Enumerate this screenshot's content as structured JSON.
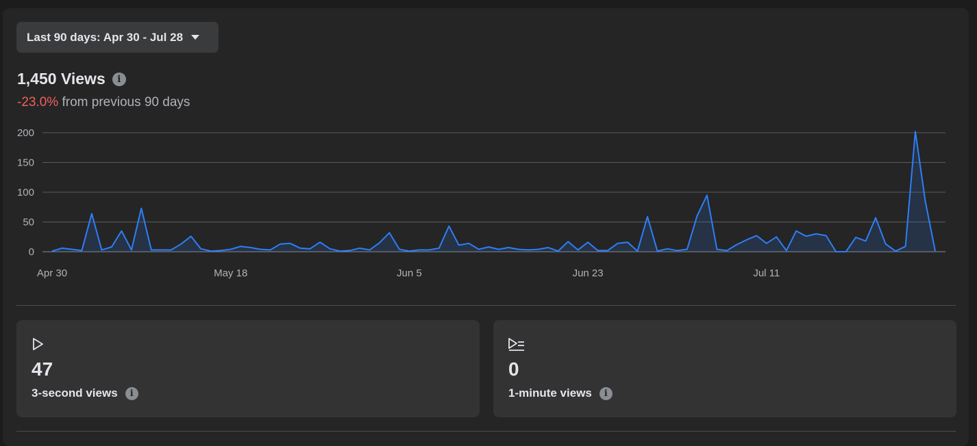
{
  "date_range": {
    "label": "Last 90 days: Apr 30 - Jul 28",
    "icon": "caret-down-icon"
  },
  "views": {
    "title": "1,450 Views",
    "info_icon": "info-icon",
    "change": "-23.0%",
    "change_suffix": " from previous 90 days",
    "change_color": "#f3615c"
  },
  "chart_data": {
    "type": "area",
    "title": "",
    "xlabel": "",
    "ylabel": "",
    "ylim": [
      0,
      200
    ],
    "yticks": [
      0,
      50,
      100,
      150,
      200
    ],
    "x_tick_labels": [
      "Apr 30",
      "May 18",
      "Jun 5",
      "Jun 23",
      "Jul 11"
    ],
    "x_tick_index": [
      0,
      18,
      36,
      54,
      72
    ],
    "series": [
      {
        "color": "#2d7ff9",
        "values": [
          1,
          6,
          4,
          2,
          64,
          3,
          8,
          35,
          3,
          73,
          3,
          3,
          3,
          13,
          26,
          5,
          1,
          2,
          4,
          9,
          7,
          4,
          3,
          13,
          14,
          6,
          5,
          16,
          5,
          1,
          2,
          6,
          3,
          15,
          32,
          4,
          1,
          3,
          3,
          6,
          43,
          11,
          14,
          4,
          8,
          4,
          7,
          4,
          3,
          4,
          7,
          1,
          17,
          3,
          16,
          2,
          2,
          14,
          16,
          1,
          59,
          1,
          5,
          2,
          4,
          60,
          95,
          4,
          2,
          12,
          20,
          27,
          14,
          25,
          2,
          35,
          26,
          30,
          27,
          0,
          0,
          24,
          18,
          57,
          13,
          1,
          9,
          202,
          85,
          1
        ]
      }
    ],
    "grid": true
  },
  "cards": [
    {
      "icon": "play-icon",
      "value": "47",
      "label": "3-second views",
      "info_icon": "info-icon"
    },
    {
      "icon": "play-list-icon",
      "value": "0",
      "label": "1-minute views",
      "info_icon": "info-icon"
    }
  ],
  "info_glyph": "i"
}
